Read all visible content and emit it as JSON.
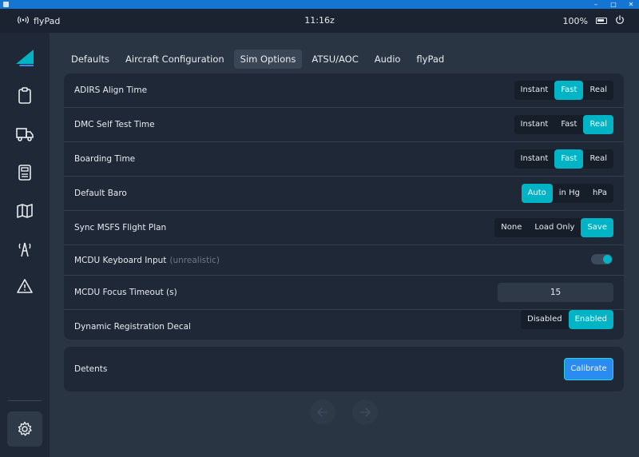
{
  "status": {
    "app_name": "flyPad",
    "time": "11:16z",
    "battery": "100%"
  },
  "tabs": [
    {
      "label": "Defaults"
    },
    {
      "label": "Aircraft Configuration"
    },
    {
      "label": "Sim Options"
    },
    {
      "label": "ATSU/AOC"
    },
    {
      "label": "Audio"
    },
    {
      "label": "flyPad"
    }
  ],
  "active_tab": "Sim Options",
  "settings": {
    "adirs": {
      "label": "ADIRS Align Time",
      "options": [
        "Instant",
        "Fast",
        "Real"
      ],
      "selected": "Fast"
    },
    "dmc": {
      "label": "DMC Self Test Time",
      "options": [
        "Instant",
        "Fast",
        "Real"
      ],
      "selected": "Real"
    },
    "boarding": {
      "label": "Boarding Time",
      "options": [
        "Instant",
        "Fast",
        "Real"
      ],
      "selected": "Fast"
    },
    "baro": {
      "label": "Default Baro",
      "options": [
        "Auto",
        "in Hg",
        "hPa"
      ],
      "selected": "Auto"
    },
    "sync": {
      "label": "Sync MSFS Flight Plan",
      "options": [
        "None",
        "Load Only",
        "Save"
      ],
      "selected": "Save"
    },
    "mcdu_keyboard": {
      "label": "MCDU Keyboard Input",
      "note": "(unrealistic)",
      "enabled": true
    },
    "mcdu_focus": {
      "label": "MCDU Focus Timeout (s)",
      "value": "15"
    },
    "decal": {
      "label": "Dynamic Registration Decal",
      "options": [
        "Disabled",
        "Enabled"
      ],
      "selected": "Enabled"
    }
  },
  "detents": {
    "label": "Detents",
    "button": "Calibrate"
  },
  "colors": {
    "accent": "#00b4c5",
    "panel": "#1f2836",
    "background": "#2a3544",
    "button": "#2a8cf0"
  }
}
